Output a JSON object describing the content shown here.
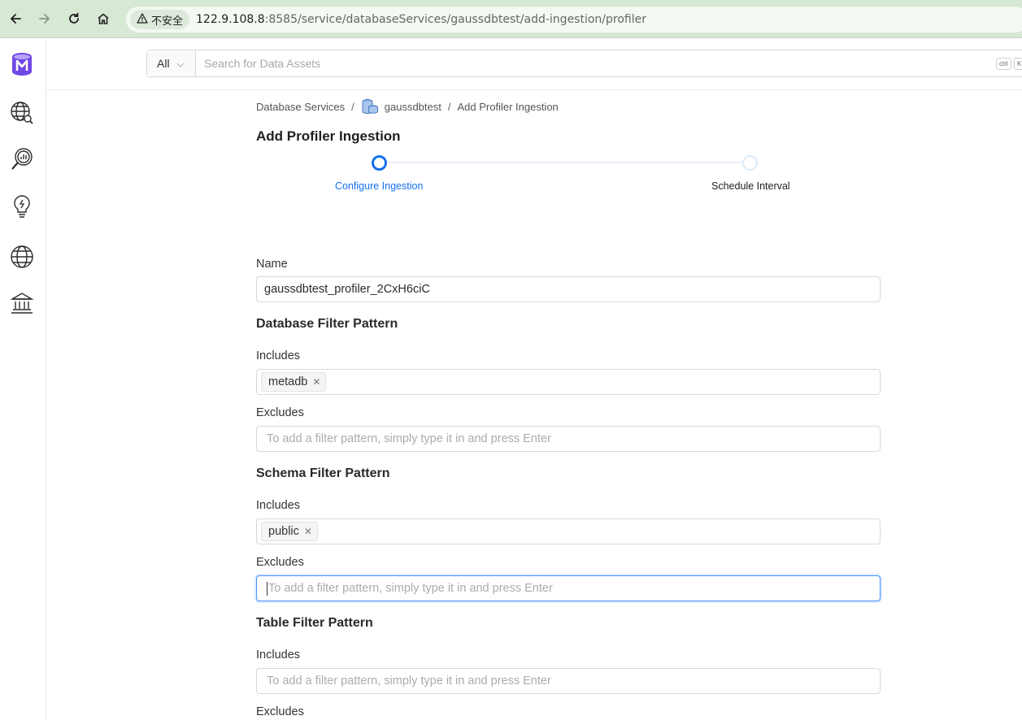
{
  "browser": {
    "security_label": "不安全",
    "url_host": "122.9.108.8",
    "url_path": ":8585/service/databaseServices/gaussdbtest/add-ingestion/profiler"
  },
  "sidebar": {
    "items": [
      {
        "name": "logo",
        "icon": "openmetadata-logo"
      },
      {
        "name": "explore",
        "icon": "globe-search-icon"
      },
      {
        "name": "data-quality",
        "icon": "magnifier-chart-icon"
      },
      {
        "name": "insights",
        "icon": "lightbulb-icon"
      },
      {
        "name": "domains",
        "icon": "globe-icon"
      },
      {
        "name": "governance",
        "icon": "bank-icon"
      }
    ]
  },
  "search": {
    "scope": "All",
    "placeholder": "Search for Data Assets",
    "shortcut_ctrl": "ctrl",
    "shortcut_key": "K"
  },
  "breadcrumb": {
    "root": "Database Services",
    "service": "gaussdbtest",
    "current": "Add Profiler Ingestion"
  },
  "page": {
    "title": "Add Profiler Ingestion"
  },
  "stepper": {
    "steps": [
      {
        "label": "Configure Ingestion",
        "state": "active"
      },
      {
        "label": "Schedule Interval",
        "state": "pending"
      }
    ]
  },
  "form": {
    "name_label": "Name",
    "name_value": "gaussdbtest_profiler_2CxH6ciC",
    "includes_label": "Includes",
    "excludes_label": "Excludes",
    "filter_placeholder": "To add a filter pattern, simply type it in and press Enter",
    "database_filter": {
      "title": "Database Filter Pattern",
      "includes": [
        "metadb"
      ],
      "excludes": []
    },
    "schema_filter": {
      "title": "Schema Filter Pattern",
      "includes": [
        "public"
      ],
      "excludes": []
    },
    "table_filter": {
      "title": "Table Filter Pattern",
      "includes": [],
      "excludes": []
    }
  },
  "colors": {
    "accent": "#1470ef",
    "browser_chrome": "#d7e8d4",
    "logo": "#7147e8"
  }
}
